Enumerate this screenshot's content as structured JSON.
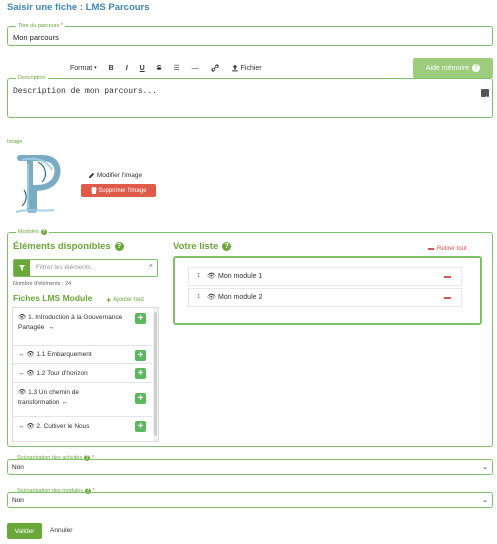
{
  "page": {
    "title": "Saisir une fiche :  LMS Parcours"
  },
  "titre": {
    "legend": "Titre du parcours",
    "required": "*",
    "value": "Mon parcours"
  },
  "toolbar": {
    "format": "Format",
    "bold": "B",
    "italic": "I",
    "underline": "U",
    "strike": "S",
    "list": "☰",
    "hr": "—",
    "link": "🔗",
    "upload_label": "Fichier"
  },
  "aide": {
    "label": "Aide mémoire",
    "help": "?"
  },
  "description": {
    "legend": "Description",
    "value": "Description de mon parcours..."
  },
  "image": {
    "label": "Image",
    "modify_label": "Modifier l'image",
    "delete_label": "Supprimer l'image"
  },
  "modules": {
    "legend": "Modules",
    "available_title": "Éléments disponibles",
    "filter_placeholder": "Filtrer les éléments",
    "count_text": "Nombre d'éléments : 24",
    "fiches_title": "Fiches LMS Module",
    "add_all": "Ajouter tout",
    "items": [
      {
        "label": "1. Introduction à la Gouvernance Partagée"
      },
      {
        "label": "1.1 Embarquement"
      },
      {
        "label": "1.2 Tour d'horizon"
      },
      {
        "label": "1.3 Un chemin de transformation"
      },
      {
        "label": "2. Cultiver le Nous"
      }
    ],
    "list_title": "Votre liste",
    "remove_all": "Retirer tout",
    "selected": [
      {
        "label": "Mon module 1"
      },
      {
        "label": "Mon module 2"
      }
    ]
  },
  "scenarisation_activites": {
    "legend": "Scénarisation des activités",
    "required": "*",
    "value": "Non"
  },
  "scenarisation_modules": {
    "legend": "Scénarisation des modules",
    "required": "*",
    "value": "Non"
  },
  "actions": {
    "submit": "Valider",
    "cancel": "Annuler"
  },
  "colors": {
    "accent": "#6aa83a",
    "title_blue": "#3f86b6",
    "danger": "#d9534f",
    "success": "#5cb85c"
  }
}
